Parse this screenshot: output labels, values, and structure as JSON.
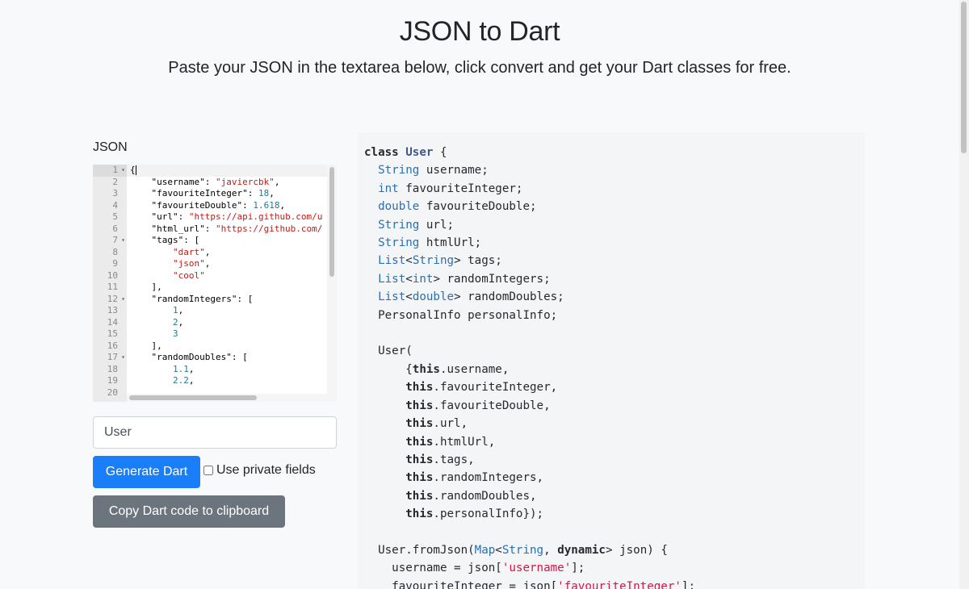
{
  "header": {
    "title": "JSON to Dart",
    "subtitle": "Paste your JSON in the textarea below, click convert and get your Dart classes for free."
  },
  "editor": {
    "label": "JSON",
    "lines": [
      {
        "n": "1",
        "fold": true,
        "html": "{<span class=\"cursor\"></span>"
      },
      {
        "n": "2",
        "fold": false,
        "html": "    \"username\": <span class=\"str\">\"javiercbk\"</span>,"
      },
      {
        "n": "3",
        "fold": false,
        "html": "    \"favouriteInteger\": <span class=\"num\">18</span>,"
      },
      {
        "n": "4",
        "fold": false,
        "html": "    \"favouriteDouble\": <span class=\"num\">1.618</span>,"
      },
      {
        "n": "5",
        "fold": false,
        "html": "    \"url\": <span class=\"str\">\"https://api.github.com/u</span>"
      },
      {
        "n": "6",
        "fold": false,
        "html": "    \"html_url\": <span class=\"str\">\"https://github.com/</span>"
      },
      {
        "n": "7",
        "fold": true,
        "html": "    \"tags\": ["
      },
      {
        "n": "8",
        "fold": false,
        "html": "        <span class=\"str\">\"dart\"</span>,"
      },
      {
        "n": "9",
        "fold": false,
        "html": "        <span class=\"str\">\"json\"</span>,"
      },
      {
        "n": "10",
        "fold": false,
        "html": "        <span class=\"str\">\"cool\"</span>"
      },
      {
        "n": "11",
        "fold": false,
        "html": "    ],"
      },
      {
        "n": "12",
        "fold": true,
        "html": "    \"randomIntegers\": ["
      },
      {
        "n": "13",
        "fold": false,
        "html": "        <span class=\"num\">1</span>,"
      },
      {
        "n": "14",
        "fold": false,
        "html": "        <span class=\"num\">2</span>,"
      },
      {
        "n": "15",
        "fold": false,
        "html": "        <span class=\"num\">3</span>"
      },
      {
        "n": "16",
        "fold": false,
        "html": "    ],"
      },
      {
        "n": "17",
        "fold": true,
        "html": "    \"randomDoubles\": ["
      },
      {
        "n": "18",
        "fold": false,
        "html": "        <span class=\"num\">1.1</span>,"
      },
      {
        "n": "19",
        "fold": false,
        "html": "        <span class=\"num\">2.2</span>,"
      },
      {
        "n": "20",
        "fold": false,
        "html": ""
      }
    ]
  },
  "form": {
    "class_name_value": "User",
    "generate_label": "Generate Dart",
    "private_label": "Use private fields",
    "private_checked": false,
    "copy_label": "Copy Dart code to clipboard"
  },
  "output": {
    "lines": [
      "<span class=\"kw\">class</span> <span class=\"cls\">User</span> {",
      "  <span class=\"ty\">String</span> username;",
      "  <span class=\"ty\">int</span> favouriteInteger;",
      "  <span class=\"ty\">double</span> favouriteDouble;",
      "  <span class=\"ty\">String</span> url;",
      "  <span class=\"ty\">String</span> htmlUrl;",
      "  <span class=\"ty\">List</span>&lt;<span class=\"ty\">String</span>&gt; tags;",
      "  <span class=\"ty\">List</span>&lt;<span class=\"ty\">int</span>&gt; randomIntegers;",
      "  <span class=\"ty\">List</span>&lt;<span class=\"ty\">double</span>&gt; randomDoubles;",
      "  PersonalInfo personalInfo;",
      "",
      "  User(",
      "      {<span class=\"kw\">this</span>.username,",
      "      <span class=\"kw\">this</span>.favouriteInteger,",
      "      <span class=\"kw\">this</span>.favouriteDouble,",
      "      <span class=\"kw\">this</span>.url,",
      "      <span class=\"kw\">this</span>.htmlUrl,",
      "      <span class=\"kw\">this</span>.tags,",
      "      <span class=\"kw\">this</span>.randomIntegers,",
      "      <span class=\"kw\">this</span>.randomDoubles,",
      "      <span class=\"kw\">this</span>.personalInfo});",
      "",
      "  User.fromJson(<span class=\"ty\">Map</span>&lt;<span class=\"ty\">String</span>, <span class=\"kw\">dynamic</span>&gt; json) {",
      "    username = json[<span class=\"os\">'username'</span>];",
      "    favouriteInteger = json[<span class=\"os\">'favouriteInteger'</span>];"
    ]
  }
}
